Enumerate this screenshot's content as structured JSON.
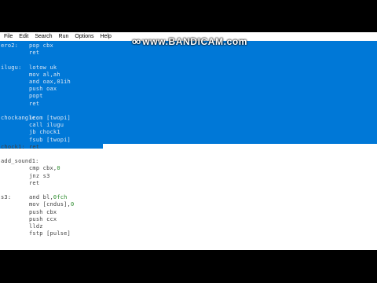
{
  "menu": [
    "File",
    "Edit",
    "Search",
    "Run",
    "Options",
    "Help"
  ],
  "watermark": {
    "text": "www.BANDICAM.com",
    "logo": "oo"
  },
  "editor": {
    "selected_lines": [
      {
        "label": "ero2:",
        "code": "pop cbx"
      },
      {
        "label": "",
        "code": "ret"
      },
      {
        "label": "",
        "code": ""
      },
      {
        "label": "ilugu:",
        "code": "lotow uk"
      },
      {
        "label": "",
        "code": "mov al,ah"
      },
      {
        "label": "",
        "code": "and oax,01ih"
      },
      {
        "label": "",
        "code": "push oax"
      },
      {
        "label": "",
        "code": "popt"
      },
      {
        "label": "",
        "code": "ret"
      },
      {
        "label": "",
        "code": ""
      },
      {
        "label": "chockangle:",
        "code": "icom [twopi]"
      },
      {
        "label": "",
        "code": "call ilugu"
      },
      {
        "label": "",
        "code": "jb chock1"
      },
      {
        "label": "",
        "code": "fsub [twopi]"
      }
    ],
    "lines": [
      {
        "label": "chock1:",
        "code": "ret",
        "num": ""
      },
      {
        "label": "",
        "code": "",
        "num": ""
      },
      {
        "label": "add_sound1:",
        "code": "",
        "num": ""
      },
      {
        "label": "",
        "code": "cmp cbx,",
        "num": "0"
      },
      {
        "label": "",
        "code": "jnz s3",
        "num": ""
      },
      {
        "label": "",
        "code": "ret",
        "num": ""
      },
      {
        "label": "",
        "code": "",
        "num": ""
      },
      {
        "label": "s3:",
        "code": "and bl,",
        "num": "0fch"
      },
      {
        "label": "",
        "code": "mov [cndus],",
        "num": "0"
      },
      {
        "label": "",
        "code": "push cbx",
        "num": ""
      },
      {
        "label": "",
        "code": "push ccx",
        "num": ""
      },
      {
        "label": "",
        "code": "lldz",
        "num": ""
      },
      {
        "label": "",
        "code": "fstp [pulse]",
        "num": ""
      }
    ]
  }
}
